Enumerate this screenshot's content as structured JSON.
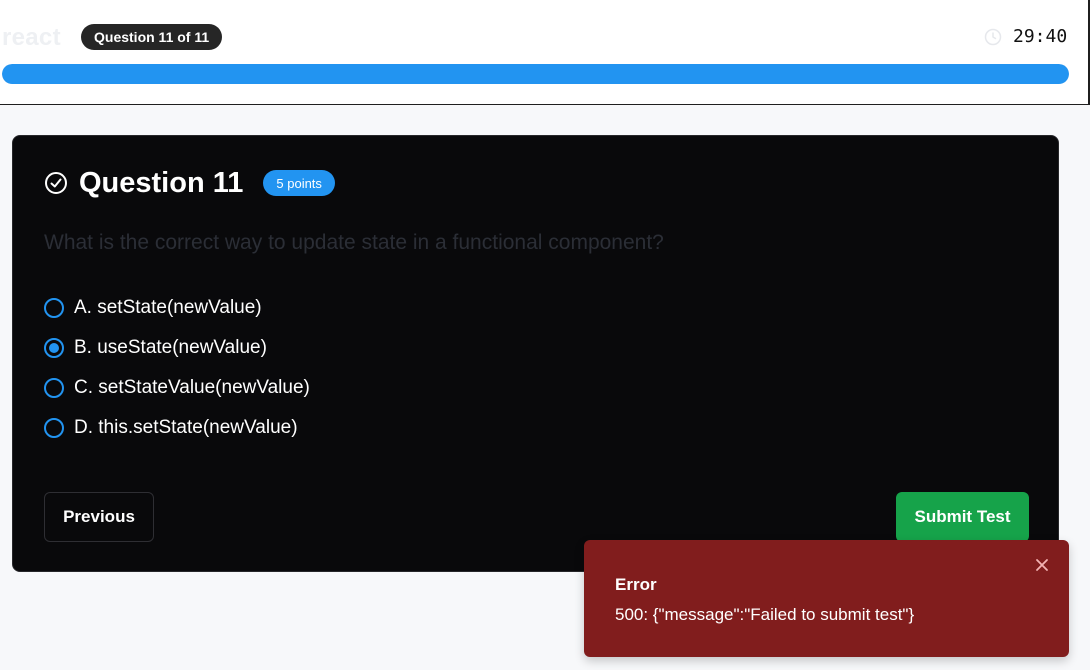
{
  "header": {
    "brand": "react",
    "question_counter": "Question 11 of 11",
    "timer": "29:40",
    "progress": 1.0
  },
  "question": {
    "title": "Question 11",
    "points": "5 points",
    "text": "What is the correct way to update state in a functional component?",
    "options": [
      {
        "label": "A. setState(newValue)",
        "selected": false
      },
      {
        "label": "B. useState(newValue)",
        "selected": true
      },
      {
        "label": "C. setStateValue(newValue)",
        "selected": false
      },
      {
        "label": "D. this.setState(newValue)",
        "selected": false
      }
    ]
  },
  "buttons": {
    "previous": "Previous",
    "submit": "Submit Test"
  },
  "toast": {
    "title": "Error",
    "message": "500: {\"message\":\"Failed to submit test\"}"
  },
  "colors": {
    "accent": "#2294f1",
    "submit": "#16a34a",
    "error": "#811d1d",
    "card": "#09090b"
  }
}
